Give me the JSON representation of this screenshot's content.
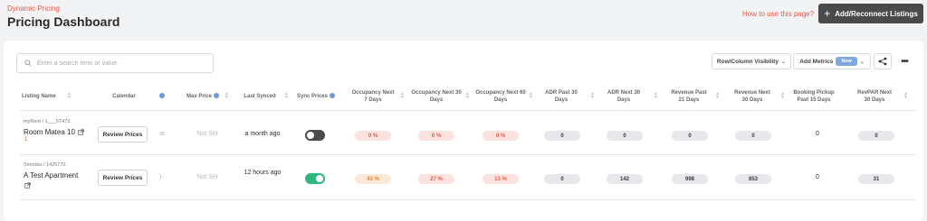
{
  "header": {
    "breadcrumb": "Dynamic Pricing",
    "title": "Pricing Dashboard",
    "help_link": "How to use this page?",
    "primary_button": "Add/Reconnect Listings"
  },
  "toolbar": {
    "search_placeholder": "Enter a search term or value",
    "row_column_visibility": "Row/Column Visibility",
    "add_metrics": "Add Metrics",
    "new_badge": "New"
  },
  "columns": {
    "listing_name": "Listing Name",
    "calendar": "Calendar",
    "min_price_partial": "",
    "max_price": "Max Price",
    "last_synced": "Last Synced",
    "sync_prices": "Sync Prices",
    "occupancy_7": "Occupancy Next 7 Days",
    "occupancy_30": "Occupancy Next 30 Days",
    "occupancy_60": "Occupancy Next 60 Days",
    "adr_past_30": "ADR Past 30 Days",
    "adr_next_30": "ADR Next 30 Days",
    "revenue_past_21": "Revenue Past 21 Days",
    "revenue_next_30": "Revenue Next 30 Days",
    "booking_pickup": "Booking Pickup Past 15 Days",
    "revpar_next_30": "RevPAR Next 30 Days"
  },
  "rows": [
    {
      "source": "myRent / 1___5T473",
      "name": "Room Matea 10",
      "red_mark": "1",
      "review_label": "Review Prices",
      "min_price_partial": "at",
      "max_price": "Not Set",
      "last_synced": "a month ago",
      "sync_on": false,
      "occ7": "0 %",
      "occ30": "0 %",
      "occ60": "0 %",
      "adr_past": "0",
      "adr_next": "0",
      "rev_past": "0",
      "rev_next": "0",
      "pickup": "0",
      "revpar": "0"
    },
    {
      "source": "Smoobu / 1425770",
      "name": "A Test Apartment",
      "red_mark": "",
      "review_label": "Review Prices",
      "min_price_partial": ")",
      "max_price": "Not Set",
      "last_synced": "12 hours ago",
      "sync_on": true,
      "occ7": "43 %",
      "occ30": "27 %",
      "occ60": "13 %",
      "adr_past": "0",
      "adr_next": "142",
      "rev_past": "998",
      "rev_next": "853",
      "pickup": "0",
      "revpar": "31"
    }
  ],
  "colors": {
    "accent": "#e8594a",
    "toggle_on": "#2fb67c",
    "toggle_off": "#4a4a4a"
  }
}
